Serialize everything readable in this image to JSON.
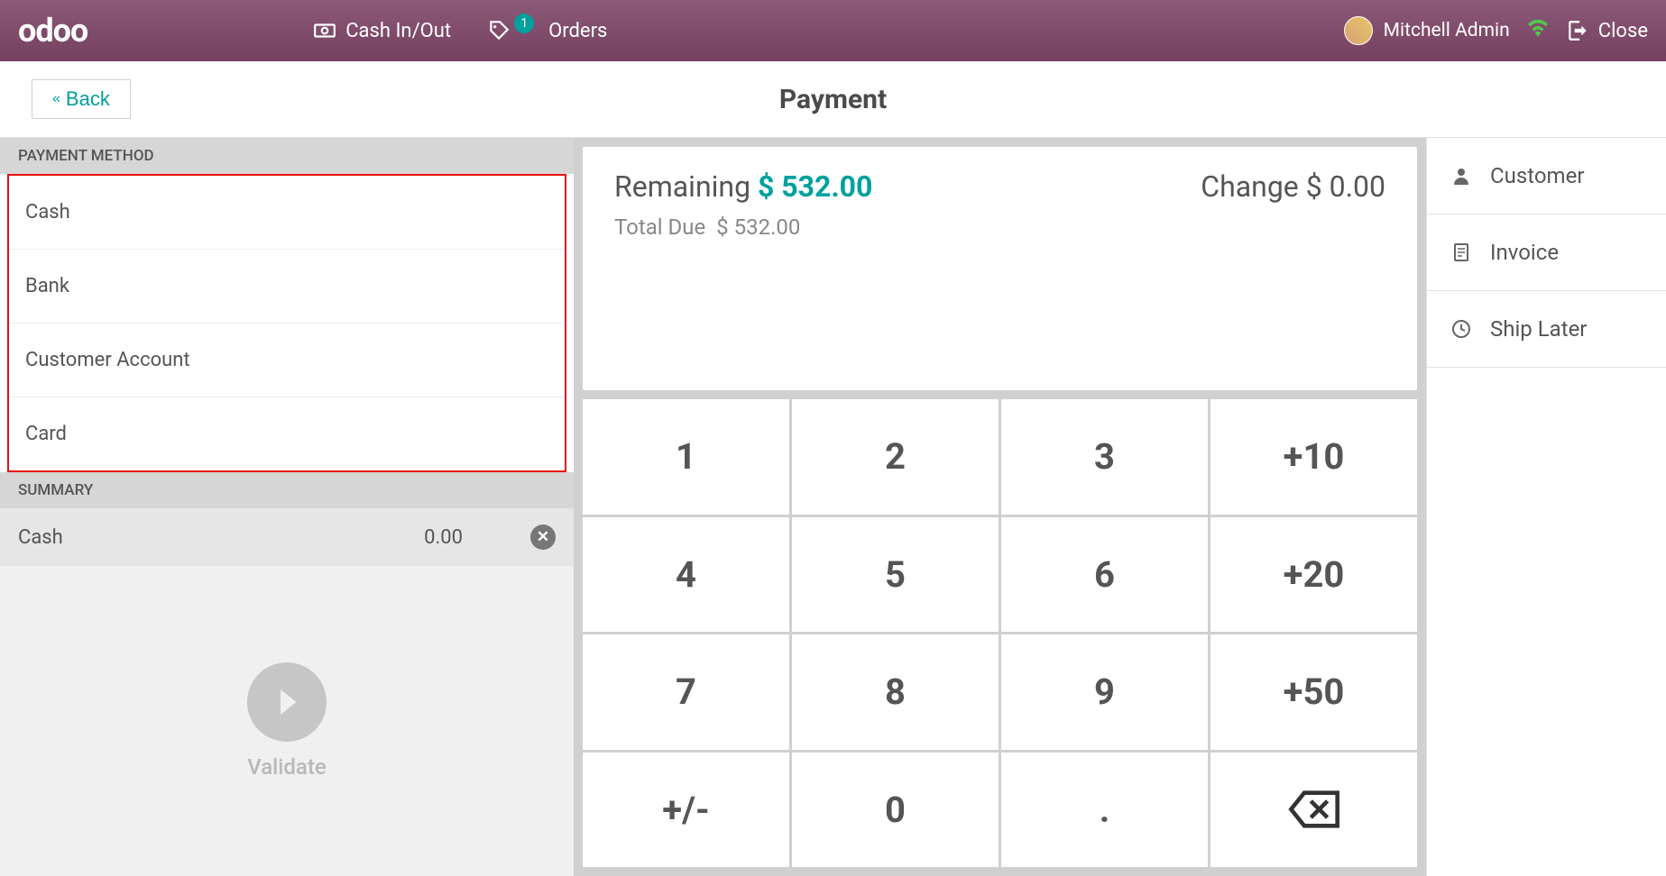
{
  "nav": {
    "logo": "odoo",
    "cash": "Cash In/Out",
    "orders": "Orders",
    "ordersBadge": "1",
    "user": "Mitchell Admin",
    "close": "Close"
  },
  "header": {
    "back": "Back",
    "title": "Payment"
  },
  "payment": {
    "sectionLabel": "PAYMENT METHOD",
    "methods": [
      "Cash",
      "Bank",
      "Customer Account",
      "Card"
    ],
    "summaryLabel": "SUMMARY",
    "summary": {
      "method": "Cash",
      "amount": "0.00"
    },
    "validate": "Validate"
  },
  "display": {
    "remainingLabel": "Remaining",
    "remaining": "$ 532.00",
    "changeLabel": "Change",
    "change": "$ 0.00",
    "totalDueLabel": "Total Due",
    "totalDue": "$ 532.00"
  },
  "numpad": [
    "1",
    "2",
    "3",
    "+10",
    "4",
    "5",
    "6",
    "+20",
    "7",
    "8",
    "9",
    "+50",
    "+/-",
    "0",
    "."
  ],
  "actions": {
    "customer": "Customer",
    "invoice": "Invoice",
    "shipLater": "Ship Later"
  }
}
